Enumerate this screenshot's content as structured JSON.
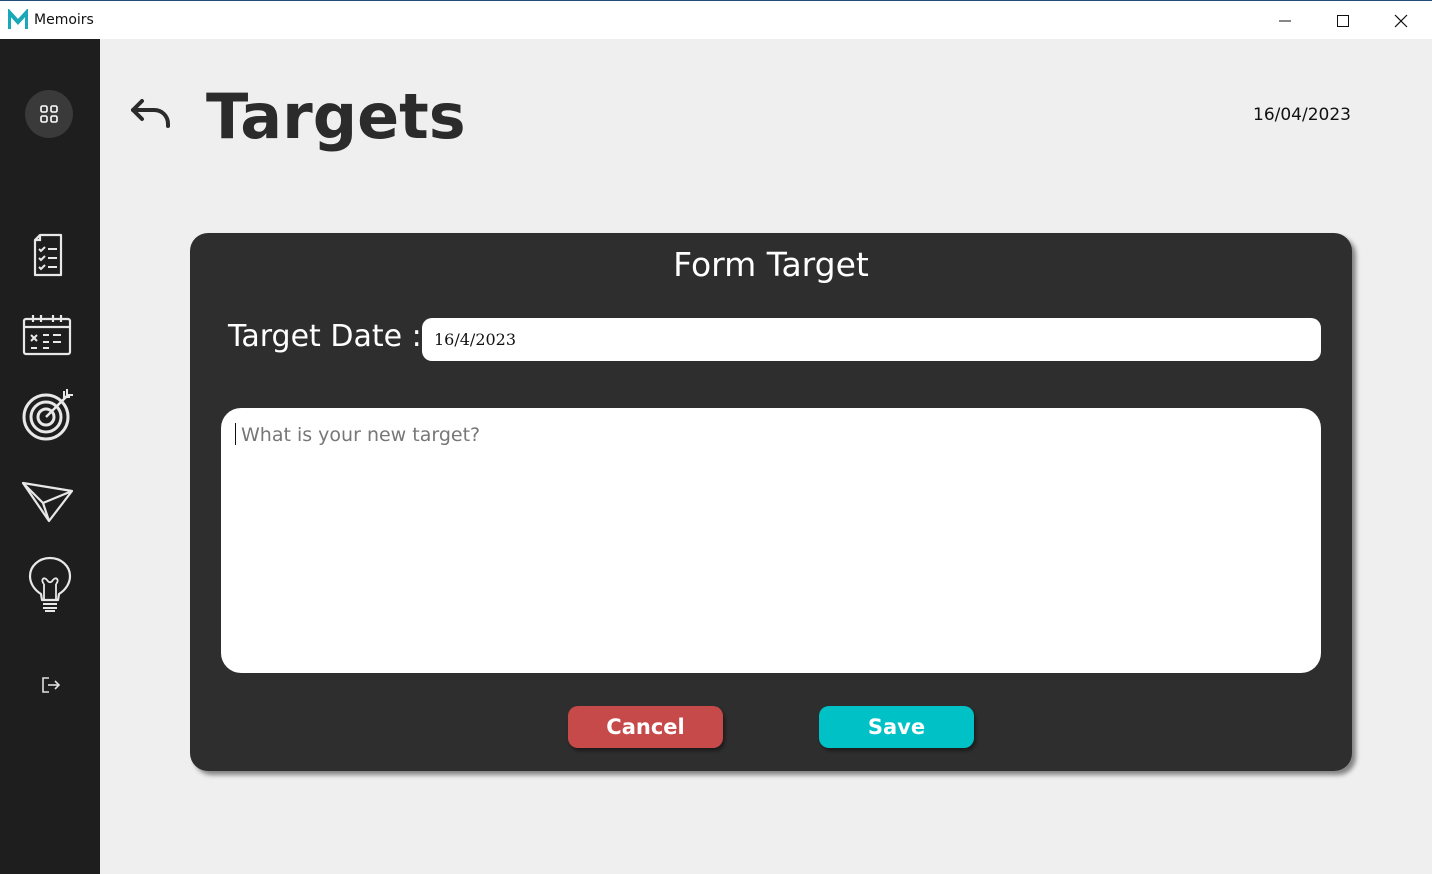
{
  "window": {
    "app_title": "Memoirs",
    "logo_letter": "M",
    "accent": "#1aa7b8"
  },
  "sidebar": {
    "items": [
      {
        "icon": "dashboard-grid-icon"
      },
      {
        "icon": "checklist-icon"
      },
      {
        "icon": "calendar-icon"
      },
      {
        "icon": "target-icon"
      },
      {
        "icon": "paper-plane-icon"
      },
      {
        "icon": "lightbulb-icon"
      },
      {
        "icon": "logout-icon"
      }
    ]
  },
  "header": {
    "title": "Targets",
    "date": "16/04/2023"
  },
  "form": {
    "title": "Form Target",
    "date_label": "Target Date :",
    "date_value": "16/4/2023",
    "target_placeholder": "What is your new target?",
    "cancel_label": "Cancel",
    "save_label": "Save",
    "colors": {
      "card": "#2e2e2e",
      "cancel": "#c64a4a",
      "save": "#00c1c6"
    }
  }
}
